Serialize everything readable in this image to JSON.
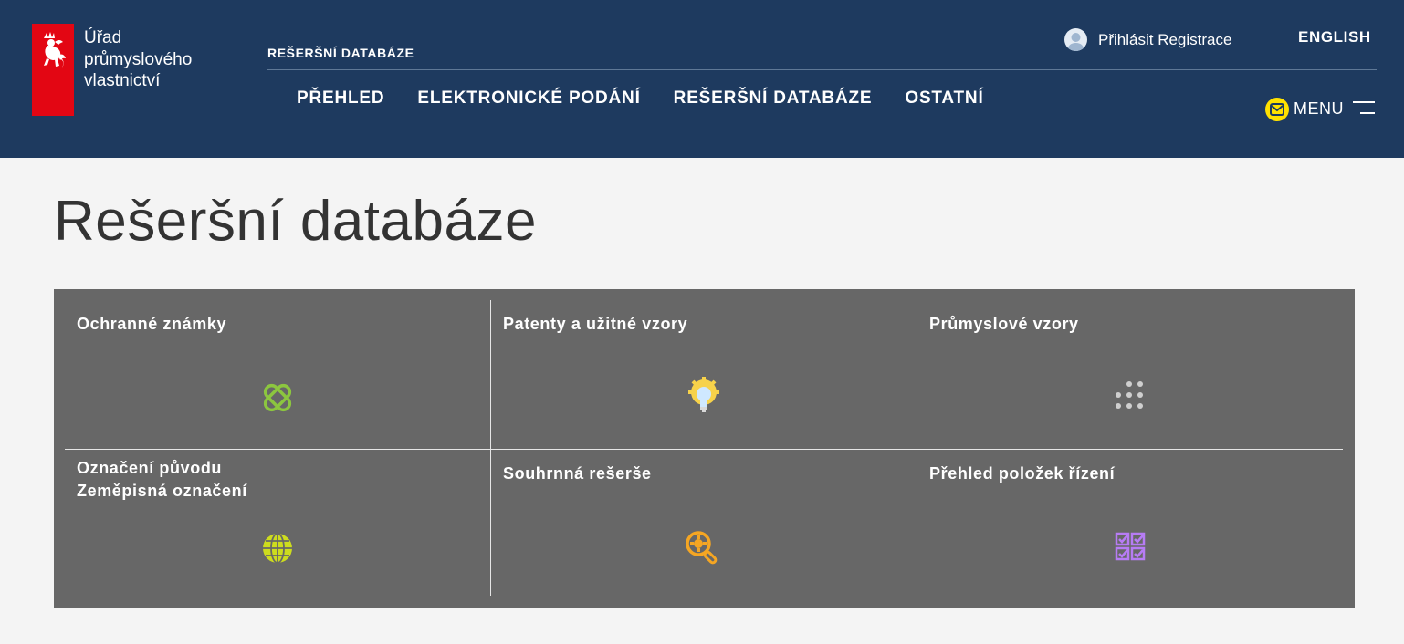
{
  "header": {
    "logo_lines": [
      "Úřad",
      "průmyslového",
      "vlastnictví"
    ],
    "section_label": "REŠERŠNÍ DATABÁZE",
    "nav": [
      "PŘEHLED",
      "ELEKTRONICKÉ PODÁNÍ",
      "REŠERŠNÍ DATABÁZE",
      "OSTATNÍ"
    ],
    "login": "Přihlásit",
    "register": "Registrace",
    "language": "ENGLISH",
    "menu": "MENU"
  },
  "page_title": "Rešeršní databáze",
  "tiles": [
    {
      "title": "Ochranné známky",
      "icon": "trademark-knot-icon",
      "color": "#8cc63f"
    },
    {
      "title": "Patenty a užitné vzory",
      "icon": "lightbulb-gear-icon",
      "color": "#f7d24a"
    },
    {
      "title": "Průmyslové vzory",
      "icon": "dot-grid-icon",
      "color": "#cfcfcf"
    },
    {
      "title_lines": [
        "Označení původu",
        "Zeměpisná označení"
      ],
      "icon": "globe-icon",
      "color": "#cddc1e"
    },
    {
      "title": "Souhrnná rešerše",
      "icon": "magnifier-gear-icon",
      "color": "#f5a623"
    },
    {
      "title": "Přehled položek řízení",
      "icon": "checklist-icon",
      "color": "#b77cf5"
    }
  ],
  "colors": {
    "header_bg": "#1e3a5f",
    "tile_bg": "#676767",
    "page_bg": "#f4f4f4",
    "logo_red": "#e30613",
    "mail_badge": "#ffe100"
  }
}
